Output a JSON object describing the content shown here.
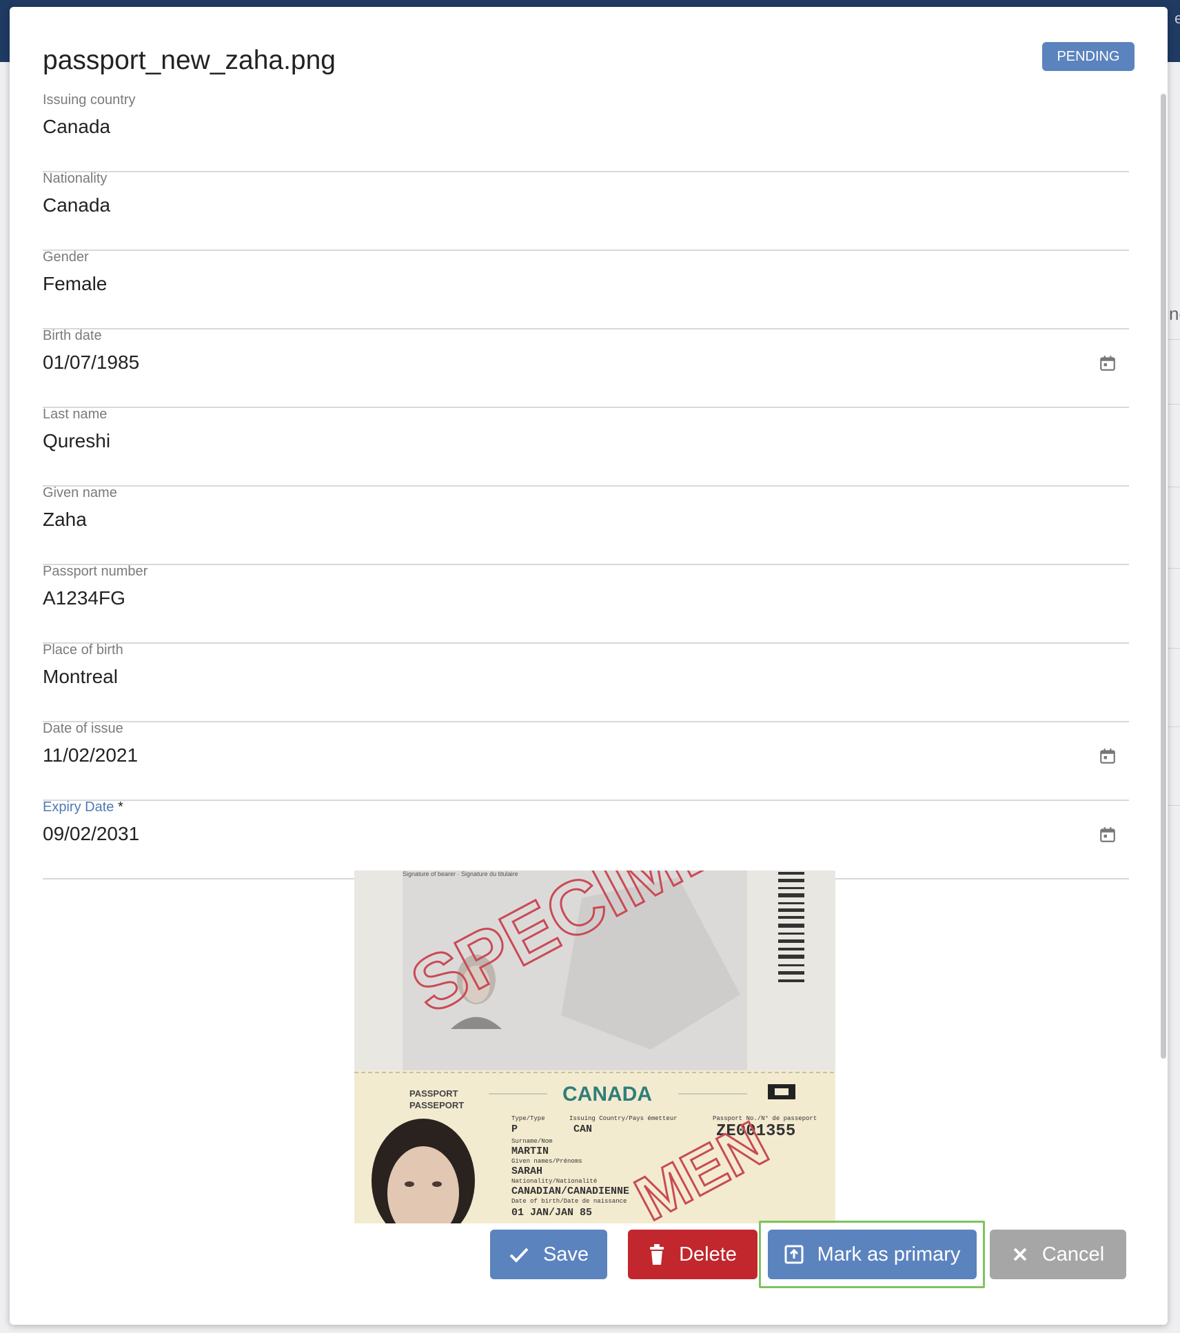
{
  "dialog": {
    "title": "passport_new_zaha.png",
    "status": "PENDING"
  },
  "background": {
    "edge_text": "ne",
    "edge_char": "e"
  },
  "fields": {
    "issuing_country": {
      "label": "Issuing country",
      "value": "Canada"
    },
    "nationality": {
      "label": "Nationality",
      "value": "Canada"
    },
    "gender": {
      "label": "Gender",
      "value": "Female"
    },
    "birth_date": {
      "label": "Birth date",
      "value": "01/07/1985"
    },
    "last_name": {
      "label": "Last name",
      "value": "Qureshi"
    },
    "given_name": {
      "label": "Given name",
      "value": "Zaha"
    },
    "passport_number": {
      "label": "Passport number",
      "value": "A1234FG"
    },
    "place_of_birth": {
      "label": "Place of birth",
      "value": "Montreal"
    },
    "date_of_issue": {
      "label": "Date of issue",
      "value": "11/02/2021"
    },
    "expiry_date": {
      "label": "Expiry Date",
      "required_mark": "*",
      "value": "09/02/2031"
    }
  },
  "passport_image": {
    "watermark_top": "SPECIMEN",
    "watermark_bottom": "MEN",
    "signature_line": "Signature of bearer · Signature du titulaire",
    "doc_label_1": "PASSPORT",
    "doc_label_2": "PASSEPORT",
    "country": "CANADA",
    "type_label": "Type/Type",
    "type_value": "P",
    "issuing_label": "Issuing Country/Pays émetteur",
    "issuing_value": "CAN",
    "passport_no_label": "Passport No./N° de passeport",
    "passport_no_value": "ZE001355",
    "surname_label": "Surname/Nom",
    "surname_value": "MARTIN",
    "given_names_label": "Given names/Prénoms",
    "given_names_value": "SARAH",
    "nationality_label": "Nationality/Nationalité",
    "nationality_value": "CANADIAN/CANADIENNE",
    "dob_label": "Date of birth/Date de naissance",
    "dob_value": "01 JAN/JAN 85"
  },
  "actions": {
    "save": "Save",
    "delete": "Delete",
    "mark_primary": "Mark as primary",
    "cancel": "Cancel"
  }
}
